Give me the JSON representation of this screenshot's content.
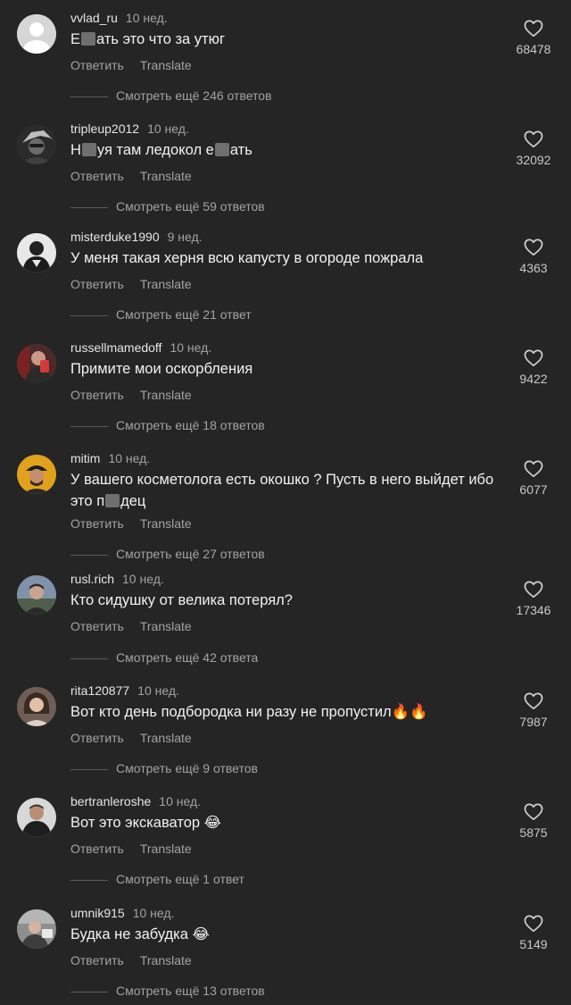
{
  "ui": {
    "reply_label": "Ответить",
    "translate_label": "Translate"
  },
  "comments": [
    {
      "username": "vvlad_ru",
      "time": "10 нед.",
      "text_parts": [
        "Е",
        "ать это что за утюг"
      ],
      "likes": "68478",
      "replies": "Смотреть ещё 246 ответов"
    },
    {
      "username": "tripleup2012",
      "time": "10 нед.",
      "text_parts": [
        "Н",
        "уя там ледокол е",
        "ать"
      ],
      "likes": "32092",
      "replies": "Смотреть ещё 59 ответов"
    },
    {
      "username": "misterduke1990",
      "time": "9 нед.",
      "text_parts": [
        "У меня такая херня всю капусту в огороде пожрала"
      ],
      "likes": "4363",
      "replies": "Смотреть ещё 21 ответ"
    },
    {
      "username": "russellmamedoff",
      "time": "10 нед.",
      "text_parts": [
        "Примите мои оскорбления"
      ],
      "likes": "9422",
      "replies": "Смотреть ещё 18 ответов"
    },
    {
      "username": "mitim",
      "time": "10 нед.",
      "text_parts": [
        "У вашего косметолога есть окошко ? Пусть в него выйдет ибо это п",
        "дец"
      ],
      "likes": "6077",
      "replies": "Смотреть ещё 27 ответов"
    },
    {
      "username": "rusl.rich",
      "time": "10 нед.",
      "text_parts": [
        "Кто сидушку от велика потерял?"
      ],
      "likes": "17346",
      "replies": "Смотреть ещё 42 ответа"
    },
    {
      "username": "rita120877",
      "time": "10 нед.",
      "text_parts": [
        "Вот кто день подбородка ни разу не пропустил🔥🔥"
      ],
      "likes": "7987",
      "replies": "Смотреть ещё 9 ответов"
    },
    {
      "username": "bertranleroshe",
      "time": "10 нед.",
      "text_parts": [
        "Вот это экскаватор 😂"
      ],
      "likes": "5875",
      "replies": "Смотреть ещё 1 ответ"
    },
    {
      "username": "umnik915",
      "time": "10 нед.",
      "text_parts": [
        "Будка не забудка 😂"
      ],
      "likes": "5149",
      "replies": "Смотреть ещё 13 ответов"
    }
  ]
}
